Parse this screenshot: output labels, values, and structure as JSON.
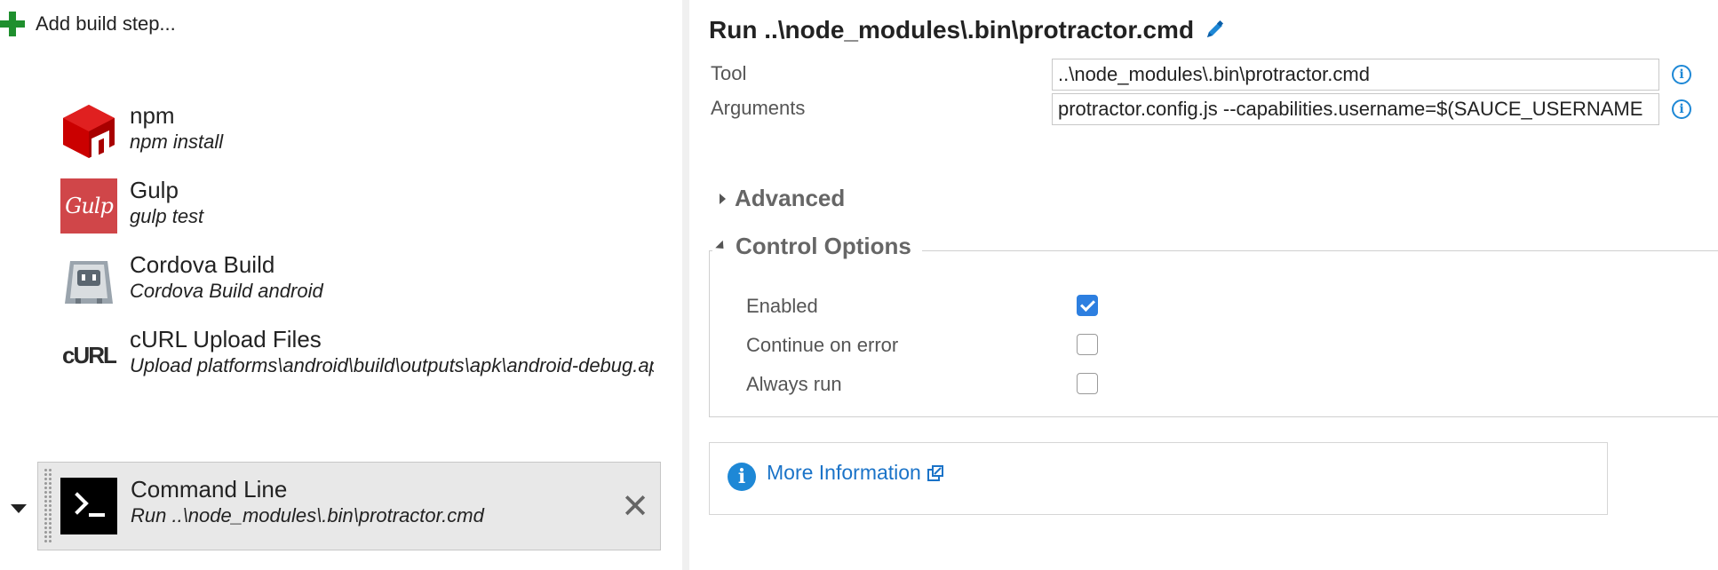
{
  "left": {
    "add_step_label": "Add build step...",
    "steps": [
      {
        "title": "npm",
        "subtitle": "npm install",
        "icon": "npm-icon"
      },
      {
        "title": "Gulp",
        "subtitle": "gulp test",
        "icon": "gulp-icon",
        "icon_text": "Gulp"
      },
      {
        "title": "Cordova Build",
        "subtitle": "Cordova Build android",
        "icon": "cordova-icon"
      },
      {
        "title": "cURL Upload Files",
        "subtitle": "Upload platforms\\android\\build\\outputs\\apk\\android-debug.apk",
        "icon": "curl-icon",
        "icon_text": "cURL"
      },
      {
        "title": "Command Line",
        "subtitle": "Run ..\\node_modules\\.bin\\protractor.cmd",
        "icon": "terminal-icon",
        "selected": true
      }
    ],
    "remove_glyph": "✕"
  },
  "right": {
    "title": "Run ..\\node_modules\\.bin\\protractor.cmd",
    "fields": {
      "tool_label": "Tool",
      "tool_value": "..\\node_modules\\.bin\\protractor.cmd",
      "arguments_label": "Arguments",
      "arguments_value": "protractor.config.js --capabilities.username=$(SAUCE_USERNAME"
    },
    "advanced_label": "Advanced",
    "control_options_label": "Control Options",
    "options": [
      {
        "label": "Enabled",
        "checked": true
      },
      {
        "label": "Continue on error",
        "checked": false
      },
      {
        "label": "Always run",
        "checked": false
      }
    ],
    "more_info_label": "More Information"
  },
  "colors": {
    "accent": "#1e88d6",
    "checkbox_checked": "#2d7fe0",
    "add_plus": "#1f8f2e",
    "npm_red": "#cb0000",
    "gulp_red": "#d04649",
    "selected_row_bg": "#e8e8e8"
  }
}
